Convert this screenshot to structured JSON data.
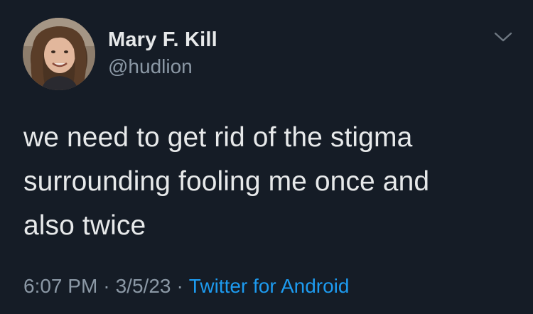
{
  "user": {
    "display_name": "Mary F. Kill",
    "handle": "@hudlion",
    "avatar_icon": "profile-photo"
  },
  "tweet": {
    "lines": [
      "we need to get rid of the stigma",
      "surrounding fooling me once and",
      "also twice"
    ]
  },
  "meta": {
    "time": "6:07 PM",
    "separator": "·",
    "date": "3/5/23",
    "source": "Twitter for Android"
  },
  "icons": {
    "more": "chevron-down-icon"
  },
  "colors": {
    "background": "#151c26",
    "text_primary": "#e7e9ea",
    "text_secondary": "#8b98a5",
    "link": "#1d9bf0"
  }
}
